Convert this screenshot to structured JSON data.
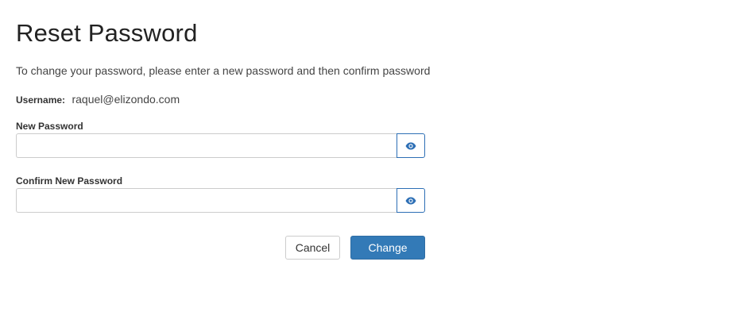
{
  "page": {
    "title": "Reset Password",
    "instructions": "To change your password, please enter a new password and then confirm password"
  },
  "account": {
    "username_label": "Username:",
    "username_value": "raquel@elizondo.com"
  },
  "fields": {
    "new_password": {
      "label": "New Password",
      "value": "",
      "toggle_icon": "eye-icon"
    },
    "confirm_password": {
      "label": "Confirm New Password",
      "value": "",
      "toggle_icon": "eye-icon"
    }
  },
  "actions": {
    "cancel_label": "Cancel",
    "change_label": "Change"
  },
  "colors": {
    "accent": "#337ab7",
    "icon": "#2d6fb5",
    "input_border": "#cccccc"
  }
}
